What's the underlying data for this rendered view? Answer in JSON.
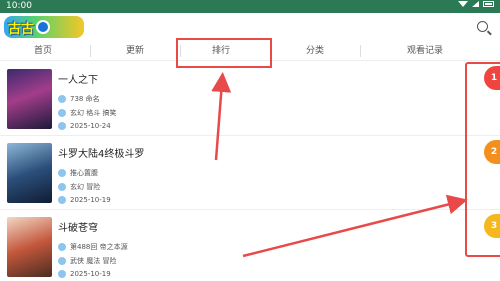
{
  "status": {
    "time": "10:00"
  },
  "app": {
    "logo_text": "古古"
  },
  "nav": {
    "tabs": [
      "首页",
      "更新",
      "排行",
      "分类",
      "观看记录"
    ]
  },
  "items": [
    {
      "rank": "1",
      "title": "一人之下",
      "line1": "738 命名",
      "line2": "玄幻 格斗 搞笑",
      "date": "2025-10-24",
      "badge_color": "#f0443f"
    },
    {
      "rank": "2",
      "title": "斗罗大陆4终极斗罗",
      "line1": "推心置腹",
      "line2": "玄幻 冒险",
      "date": "2025-10-19",
      "badge_color": "#f38f1c"
    },
    {
      "rank": "3",
      "title": "斗破苍穹",
      "line1": "第488回 帝之本源",
      "line2": "武侠 魔法 冒险",
      "date": "2025-10-19",
      "badge_color": "#f5b81c"
    }
  ]
}
